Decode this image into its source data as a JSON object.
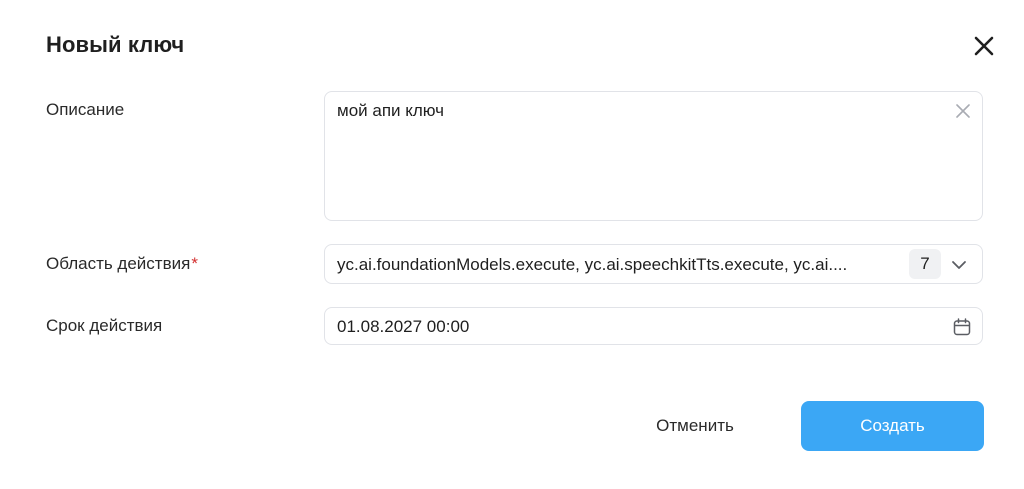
{
  "dialog": {
    "title": "Новый ключ",
    "close_icon": "close-icon"
  },
  "form": {
    "description": {
      "label": "Описание",
      "value": "мой апи ключ",
      "clear_icon": "clear-icon"
    },
    "scope": {
      "label": "Область действия",
      "required_mark": "*",
      "value": "yc.ai.foundationModels.execute, yc.ai.speechkitTts.execute, yc.ai....",
      "count": "7",
      "chevron_icon": "chevron-down-icon"
    },
    "expiry": {
      "label": "Срок действия",
      "value": "01.08.2027 00:00",
      "calendar_icon": "calendar-icon"
    }
  },
  "actions": {
    "cancel_label": "Отменить",
    "create_label": "Создать"
  },
  "colors": {
    "primary_button": "#3ba7f5",
    "required_mark": "#d32f2f",
    "field_border": "#e1e3e8",
    "badge_bg": "#f0f1f3"
  }
}
